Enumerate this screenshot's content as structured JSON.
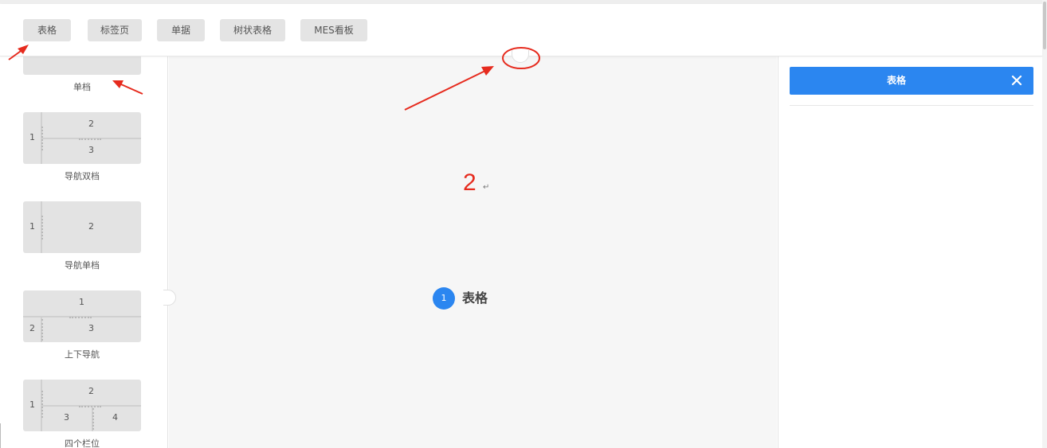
{
  "toolbar": {
    "tabs": [
      {
        "label": "表格"
      },
      {
        "label": "标签页"
      },
      {
        "label": "单据"
      },
      {
        "label": "树状表格"
      },
      {
        "label": "MES看板"
      }
    ]
  },
  "layouts": [
    {
      "caption": "单档"
    },
    {
      "caption": "导航双档",
      "cells": [
        "1",
        "2",
        "3"
      ]
    },
    {
      "caption": "导航单档",
      "cells": [
        "1",
        "2"
      ]
    },
    {
      "caption": "上下导航",
      "cells": [
        "1",
        "2",
        "3"
      ]
    },
    {
      "caption": "四个栏位",
      "cells": [
        "1",
        "2",
        "3",
        "4"
      ]
    }
  ],
  "canvas": {
    "annotation_number": "2",
    "annotation_return_mark": "↵",
    "step": {
      "number": "1",
      "label": "表格"
    }
  },
  "right_panel": {
    "selected_title": "表格",
    "close_icon": "close-icon"
  },
  "colors": {
    "accent": "#2b86f0",
    "annotation_red": "#e62b1e",
    "tab_bg": "#e4e4e4",
    "card_bg": "#e3e3e3"
  },
  "icons": [
    "close-icon",
    "collapse-handle-icon",
    "annotation-arrow",
    "annotation-circle"
  ]
}
